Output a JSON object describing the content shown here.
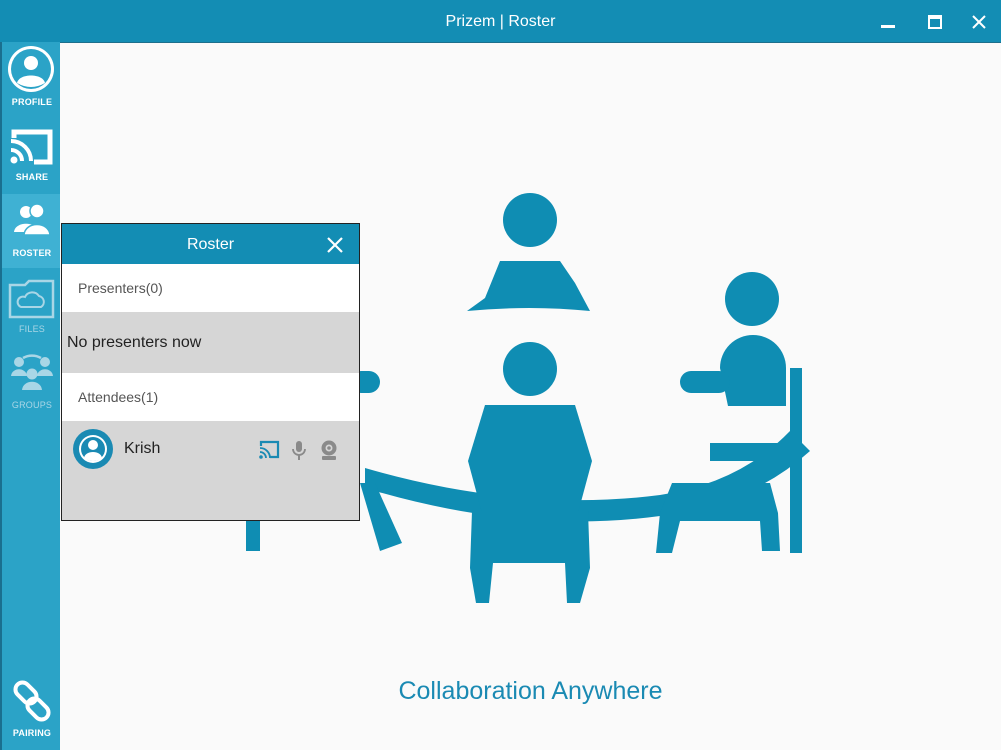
{
  "window": {
    "title": "Prizem | Roster"
  },
  "sidebar": {
    "profile": "PROFILE",
    "share": "SHARE",
    "roster": "ROSTER",
    "files": "FILES",
    "groups": "GROUPS",
    "pairing": "PAIRING"
  },
  "roster_panel": {
    "title": "Roster",
    "presenters_heading": "Presenters(0)",
    "presenters_empty": "No presenters now",
    "attendees_heading": "Attendees(1)",
    "attendees": [
      {
        "name": "Krish"
      }
    ]
  },
  "main": {
    "tagline": "Collaboration Anywhere"
  },
  "colors": {
    "brand": "#138db4",
    "sidebar": "#2ba3c7",
    "illustration": "#0f8db3",
    "panel_bg": "#d6d6d6"
  }
}
